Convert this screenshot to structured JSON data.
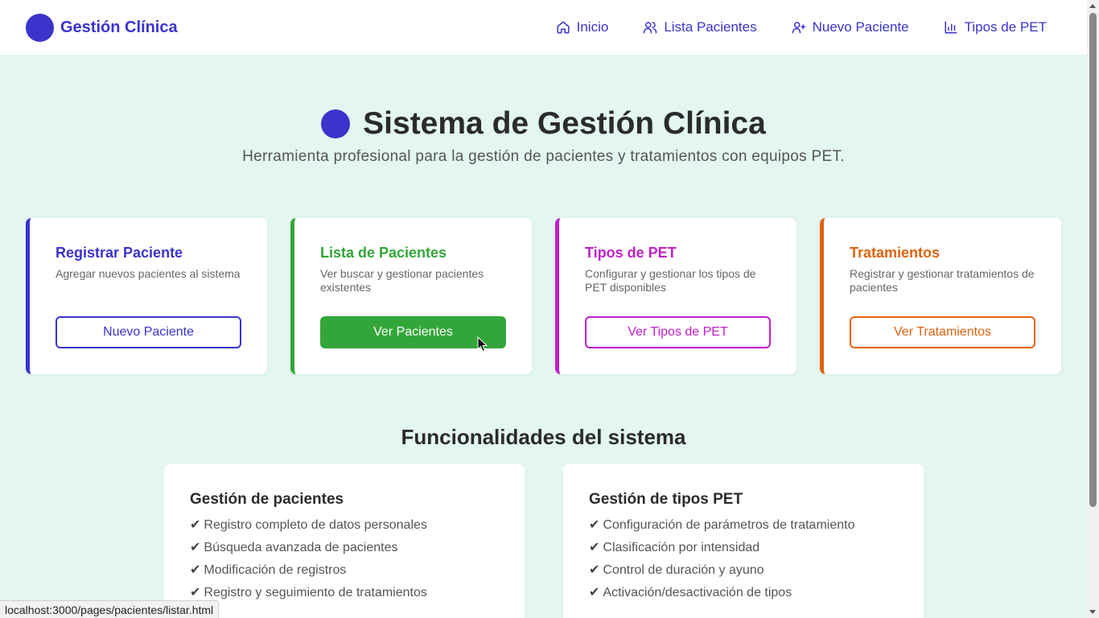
{
  "header": {
    "brand": "Gestión Clínica",
    "nav": [
      {
        "label": "Inicio",
        "icon": "home-icon"
      },
      {
        "label": "Lista Pacientes",
        "icon": "users-icon"
      },
      {
        "label": "Nuevo Paciente",
        "icon": "user-plus-icon"
      },
      {
        "label": "Tipos de PET",
        "icon": "bar-chart-icon"
      }
    ]
  },
  "hero": {
    "title": "Sistema de Gestión Clínica",
    "subtitle": "Herramienta profesional para la gestión de pacientes y tratamientos con equipos PET."
  },
  "cards": [
    {
      "title": "Registrar Paciente",
      "description": "Agregar nuevos pacientes al sistema",
      "button": "Nuevo Paciente",
      "color": "#3a34cc",
      "filled": false
    },
    {
      "title": "Lista de Pacientes",
      "description": "Ver buscar y gestionar pacientes existentes",
      "button": "Ver Pacientes",
      "color": "#33a63a",
      "filled": true
    },
    {
      "title": "Tipos de PET",
      "description": "Configurar y gestionar los tipos de PET disponibles",
      "button": "Ver Tipos de PET",
      "color": "#c020c8",
      "filled": false
    },
    {
      "title": "Tratamientos",
      "description": "Registrar y gestionar tratamientos de pacientes",
      "button": "Ver Tratamientos",
      "color": "#e0630f",
      "filled": false
    }
  ],
  "features": {
    "title": "Funcionalidades del sistema",
    "sections": [
      {
        "title": "Gestión de pacientes",
        "items": [
          "Registro completo de datos personales",
          "Búsqueda avanzada de pacientes",
          "Modificación de registros",
          "Registro y seguimiento de tratamientos"
        ]
      },
      {
        "title": "Gestión de tipos PET",
        "items": [
          "Configuración de parámetros de tratamiento",
          "Clasificación por intensidad",
          "Control de duración y ayuno",
          "Activación/desactivación de tipos"
        ]
      }
    ],
    "check_glyph": "✔"
  },
  "status_bar": {
    "url": "localhost:3000/pages/pacientes/listar.html"
  }
}
